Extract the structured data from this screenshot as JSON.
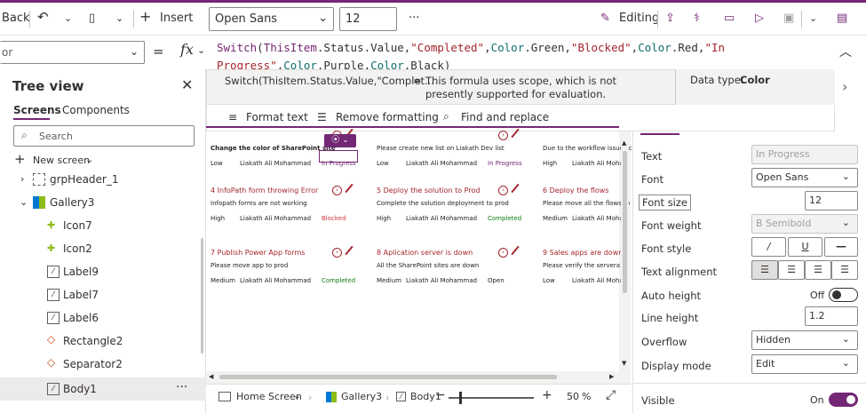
{
  "toolbar": {
    "back_label": "Back",
    "insert_label": "Insert",
    "font_value": "Open Sans",
    "size_value": "12",
    "more_label": "···",
    "editing_label": "Editing"
  },
  "formula_bar": {
    "property_value": "or",
    "equals": "=",
    "fx": "fx",
    "parts": [
      {
        "t": "Switch",
        "c": "f-fn"
      },
      {
        "t": "(",
        "c": ""
      },
      {
        "t": "ThisItem",
        "c": "f-fn"
      },
      {
        "t": ".Status.Value,",
        "c": ""
      },
      {
        "t": "\"Completed\"",
        "c": "f-str"
      },
      {
        "t": ",",
        "c": ""
      },
      {
        "t": "Color",
        "c": "f-prop"
      },
      {
        "t": ".Green,",
        "c": ""
      },
      {
        "t": "\"Blocked\"",
        "c": "f-str"
      },
      {
        "t": ",",
        "c": ""
      },
      {
        "t": "Color",
        "c": "f-prop"
      },
      {
        "t": ".Red,",
        "c": ""
      },
      {
        "t": "\"In Progress\"",
        "c": "f-str"
      },
      {
        "t": ",",
        "c": ""
      },
      {
        "t": "Color",
        "c": "f-prop"
      },
      {
        "t": ".Purple,",
        "c": ""
      },
      {
        "t": "Color",
        "c": "f-prop"
      },
      {
        "t": ".Black)",
        "c": ""
      }
    ]
  },
  "tooltip": {
    "expr": "Switch(ThisItem.Status.Value,\"Complet...",
    "eq": "=",
    "message": "This formula uses scope, which is not presently supported for evaluation.",
    "data_type_label": "Data type:",
    "data_type_value": "Color",
    "format_text": "Format text",
    "remove_formatting": "Remove formatting",
    "find_replace": "Find and replace"
  },
  "tree": {
    "title": "Tree view",
    "tab_screens": "Screens",
    "tab_components": "Components",
    "search_placeholder": "Search",
    "new_screen": "New screen",
    "items": [
      "grpHeader_1",
      "Gallery3",
      "Icon7",
      "Icon2",
      "Label9",
      "Label7",
      "Label6",
      "Rectangle2",
      "Separator2",
      "Body1"
    ],
    "more": "···"
  },
  "gallery": {
    "cards": [
      {
        "title": "",
        "desc": "Change the color of SharePoint site",
        "priority": "Low",
        "assignee": "Liakath Ali Mohammad",
        "status": "In Progress",
        "status_color": "#742774"
      },
      {
        "title": "",
        "desc": "Please create new list on Liakath Dev list",
        "priority": "Low",
        "assignee": "Liakath Ali Mohammad",
        "status": "In Progress",
        "status_color": "#742774"
      },
      {
        "title": "",
        "desc": "Due to the workflow issues c",
        "priority": "High",
        "assignee": "Liakath Ali Moha",
        "status": "",
        "status_color": "#201f1e"
      },
      {
        "title": "4  InfoPath form throwing Error",
        "desc": "Infopath forms are not working",
        "priority": "High",
        "assignee": "Liakath Ali Mohammad",
        "status": "Blocked",
        "status_color": "#d13438"
      },
      {
        "title": "5  Deploy the solution to Prod",
        "desc": "Complete the solution deployment to prod",
        "priority": "High",
        "assignee": "Liakath Ali Mohammad",
        "status": "Completed",
        "status_color": "#107c10"
      },
      {
        "title": "6  Deploy the flows",
        "desc": "Please move all the flows to",
        "priority": "Medium",
        "assignee": "Liakath Ali Moha",
        "status": "",
        "status_color": "#201f1e"
      },
      {
        "title": "7  Publish Power App forms",
        "desc": "Please move app to prod",
        "priority": "Medium",
        "assignee": "Liakath Ali Mohammad",
        "status": "Completed",
        "status_color": "#107c10"
      },
      {
        "title": "8  Aplication server is down",
        "desc": "All the SharePoint sites are down",
        "priority": "Medium",
        "assignee": "Liakath Ali Mohammad",
        "status": "Open",
        "status_color": "#201f1e"
      },
      {
        "title": "9  Sales apps are down",
        "desc": "Please verify the servera",
        "priority": "Low",
        "assignee": "Liakath Ali Moha",
        "status": "",
        "status_color": "#201f1e"
      }
    ]
  },
  "bottom": {
    "screen": "Home Screen",
    "gallery": "Gallery3",
    "body": "Body1",
    "zoom": "50",
    "zoom_unit": "%",
    "zoom_minus": "−",
    "zoom_plus": "+"
  },
  "props": {
    "text_label": "Text",
    "text_value": "In Progress",
    "font_label": "Font",
    "font_value": "Open Sans",
    "font_size_label": "Font size",
    "font_size_value": "12",
    "font_weight_label": "Font weight",
    "font_weight_value": "B  Semibold",
    "font_style_label": "Font style",
    "text_alignment_label": "Text alignment",
    "auto_height_label": "Auto height",
    "auto_height_value": "Off",
    "line_height_label": "Line height",
    "line_height_value": "1.2",
    "overflow_label": "Overflow",
    "overflow_value": "Hidden",
    "display_mode_label": "Display mode",
    "display_mode_value": "Edit",
    "visible_label": "Visible",
    "visible_value": "On"
  },
  "colors": {
    "accent": "#742774",
    "status_red": "#d13438",
    "status_green": "#107c10",
    "title_red": "#a4262c"
  }
}
